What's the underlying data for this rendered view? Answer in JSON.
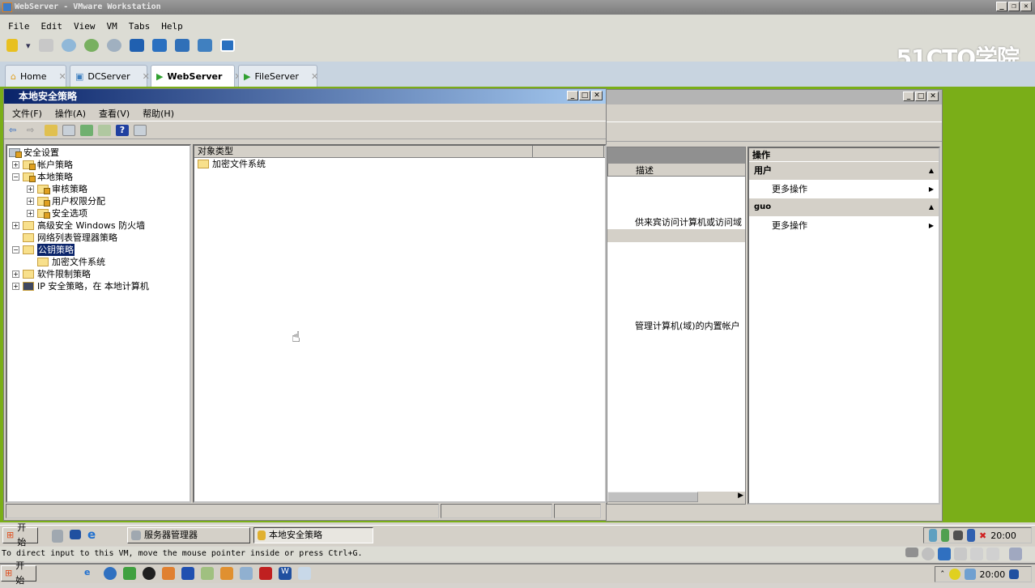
{
  "window": {
    "title": "WebServer - VMware Workstation",
    "logo": "51CTO学院"
  },
  "menu": [
    "File",
    "Edit",
    "View",
    "VM",
    "Tabs",
    "Help"
  ],
  "tabs": [
    {
      "label": "Home",
      "active": false
    },
    {
      "label": "DCServer",
      "active": false
    },
    {
      "label": "WebServer",
      "active": true
    },
    {
      "label": "FileServer",
      "active": false
    }
  ],
  "policy": {
    "title": "本地安全策略",
    "menu": [
      "文件(F)",
      "操作(A)",
      "查看(V)",
      "帮助(H)"
    ],
    "tree": [
      {
        "label": "安全设置",
        "level": 0,
        "toggle": ""
      },
      {
        "label": "帐户策略",
        "level": 1,
        "toggle": "+"
      },
      {
        "label": "本地策略",
        "level": 1,
        "toggle": "-"
      },
      {
        "label": "审核策略",
        "level": 2,
        "toggle": "+"
      },
      {
        "label": "用户权限分配",
        "level": 2,
        "toggle": "+"
      },
      {
        "label": "安全选项",
        "level": 2,
        "toggle": "+"
      },
      {
        "label": "高级安全 Windows 防火墙",
        "level": 1,
        "toggle": "+"
      },
      {
        "label": "网络列表管理器策略",
        "level": 1,
        "toggle": ""
      },
      {
        "label": "公钥策略",
        "level": 1,
        "toggle": "-",
        "selected": true
      },
      {
        "label": "加密文件系统",
        "level": 2,
        "toggle": ""
      },
      {
        "label": "软件限制策略",
        "level": 1,
        "toggle": "+"
      },
      {
        "label": "IP 安全策略，在 本地计算机",
        "level": 1,
        "toggle": "+"
      }
    ],
    "list_header": "对象类型",
    "list_items": [
      "加密文件系统"
    ]
  },
  "back": {
    "column": "描述",
    "desc1": "供来宾访问计算机或访问域",
    "desc2": "管理计算机(域)的内置帐户",
    "actions_title": "操作",
    "groups": [
      {
        "label": "用户",
        "item": "更多操作"
      },
      {
        "label": "guo",
        "item": "更多操作"
      }
    ]
  },
  "guest_taskbar": {
    "start": "开始",
    "items": [
      "服务器管理器",
      "本地安全策略"
    ],
    "time": "20:00"
  },
  "vm_status": "To direct input to this VM, move the mouse pointer inside or press Ctrl+G.",
  "host_taskbar": {
    "start": "开始",
    "time": "20:00"
  },
  "colors": {
    "desktop": "#7aae18",
    "selection": "#0a246a"
  }
}
